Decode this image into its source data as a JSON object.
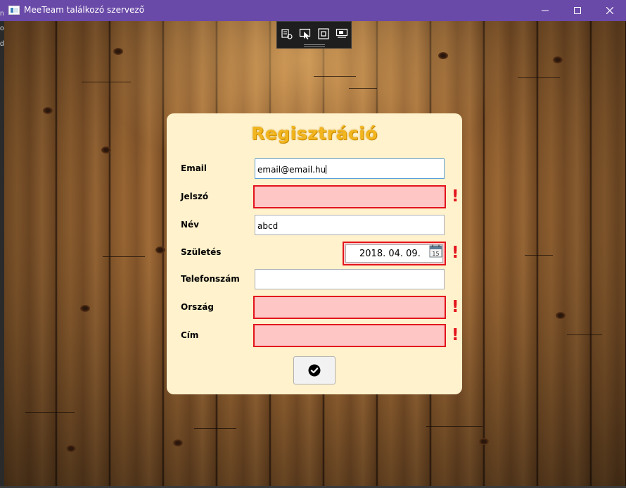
{
  "window": {
    "title": "MeeTeam találkozó szervező",
    "accent": "#6a4aa8",
    "left_edge_chars": [
      "n",
      "o",
      "d"
    ]
  },
  "devtools": {
    "buttons": [
      "select-element-icon",
      "track-focus-icon",
      "layout-adorner-icon",
      "binding-icon"
    ]
  },
  "form": {
    "title": "Regisztráció",
    "title_color": "#f2b51e",
    "error_color": "#e3141c",
    "error_fill": "#ffc6c6",
    "fields": {
      "email": {
        "label": "Email",
        "value": "email@email.hu",
        "state": "focused"
      },
      "password": {
        "label": "Jelszó",
        "value": "",
        "state": "error",
        "error_mark": "!"
      },
      "name": {
        "label": "Név",
        "value": "abcd",
        "state": "normal"
      },
      "birth": {
        "label": "Születés",
        "value": "2018. 04. 09.",
        "state": "error",
        "error_mark": "!",
        "calendar_icon_text": "15"
      },
      "phone": {
        "label": "Telefonszám",
        "value": "",
        "state": "normal"
      },
      "country": {
        "label": "Ország",
        "value": "",
        "state": "error",
        "error_mark": "!"
      },
      "address": {
        "label": "Cím",
        "value": "",
        "state": "error",
        "error_mark": "!"
      }
    },
    "submit_icon": "check-circle-icon"
  }
}
